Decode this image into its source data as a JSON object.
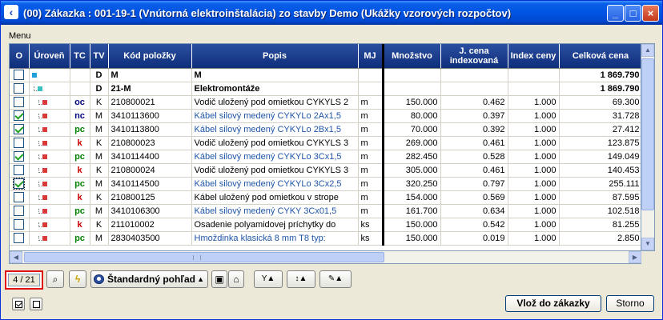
{
  "window": {
    "title": "(00)  Zákazka :  001-19-1 (Vnútorná elektroinštalácia) zo stavby Demo (Ukážky vzorových rozpočtov)",
    "min_glyph": "_",
    "max_glyph": "□",
    "close_glyph": "×"
  },
  "menu": {
    "label": "Menu"
  },
  "grid": {
    "columns": [
      "O",
      "Úroveň",
      "TC",
      "TV",
      "Kód položky",
      "Popis",
      "MJ",
      "Množstvo",
      "J. cena indexovaná",
      "Index ceny",
      "Celková cena"
    ],
    "rows": [
      {
        "checked": false,
        "level": "blue",
        "tc": "",
        "tc_color": "",
        "tv": "D",
        "code": "M",
        "desc": "M",
        "desc_color": "black",
        "mj": "",
        "qty": "",
        "price": "",
        "index": "",
        "total": "1 869.790",
        "bold": true
      },
      {
        "checked": false,
        "level": "teal",
        "tc": "",
        "tc_color": "",
        "tv": "D",
        "code": "21-M",
        "desc": "Elektromontáže",
        "desc_color": "black",
        "mj": "",
        "qty": "",
        "price": "",
        "index": "",
        "total": "1 869.790",
        "bold": true
      },
      {
        "checked": false,
        "level": "red",
        "tc": "oc",
        "tc_color": "navy",
        "tv": "K",
        "code": "210800021",
        "desc": "Vodič uložený pod omietkou CYKYLS 2",
        "desc_color": "black",
        "mj": "m",
        "qty": "150.000",
        "price": "0.462",
        "index": "1.000",
        "total": "69.300",
        "bold": false
      },
      {
        "checked": true,
        "level": "red",
        "tc": "nc",
        "tc_color": "navy",
        "tv": "M",
        "code": "3410113600",
        "desc": "Kábel silový medený CYKYLo 2Ax1,5",
        "desc_color": "blue",
        "mj": "m",
        "qty": "80.000",
        "price": "0.397",
        "index": "1.000",
        "total": "31.728",
        "bold": false
      },
      {
        "checked": true,
        "level": "red",
        "tc": "pc",
        "tc_color": "green",
        "tv": "M",
        "code": "3410113800",
        "desc": "Kábel silový medený CYKYLo 2Bx1,5",
        "desc_color": "blue",
        "mj": "m",
        "qty": "70.000",
        "price": "0.392",
        "index": "1.000",
        "total": "27.412",
        "bold": false
      },
      {
        "checked": false,
        "level": "red",
        "tc": "k",
        "tc_color": "red",
        "tv": "K",
        "code": "210800023",
        "desc": "Vodič uložený pod omietkou CYKYLS 3",
        "desc_color": "black",
        "mj": "m",
        "qty": "269.000",
        "price": "0.461",
        "index": "1.000",
        "total": "123.875",
        "bold": false
      },
      {
        "checked": true,
        "level": "red",
        "tc": "pc",
        "tc_color": "green",
        "tv": "M",
        "code": "3410114400",
        "desc": "Kábel silový medený CYKYLo 3Cx1,5",
        "desc_color": "blue",
        "mj": "m",
        "qty": "282.450",
        "price": "0.528",
        "index": "1.000",
        "total": "149.049",
        "bold": false
      },
      {
        "checked": false,
        "level": "red",
        "tc": "k",
        "tc_color": "red",
        "tv": "K",
        "code": "210800024",
        "desc": "Vodič uložený pod omietkou CYKYLS 3",
        "desc_color": "black",
        "mj": "m",
        "qty": "305.000",
        "price": "0.461",
        "index": "1.000",
        "total": "140.453",
        "bold": false
      },
      {
        "checked": true,
        "level": "red",
        "tc": "pc",
        "tc_color": "green",
        "tv": "M",
        "code": "3410114500",
        "desc": "Kábel silový medený CYKYLo 3Cx2,5",
        "desc_color": "blue",
        "mj": "m",
        "qty": "320.250",
        "price": "0.797",
        "index": "1.000",
        "total": "255.111",
        "bold": false,
        "focus": true
      },
      {
        "checked": false,
        "level": "red",
        "tc": "k",
        "tc_color": "red",
        "tv": "K",
        "code": "210800125",
        "desc": "Kábel uložený pod omietkou v strope",
        "desc_color": "black",
        "mj": "m",
        "qty": "154.000",
        "price": "0.569",
        "index": "1.000",
        "total": "87.595",
        "bold": false
      },
      {
        "checked": false,
        "level": "red",
        "tc": "pc",
        "tc_color": "green",
        "tv": "M",
        "code": "3410106300",
        "desc": "Kábel silový medený CYKY  3Cx01,5",
        "desc_color": "blue",
        "mj": "m",
        "qty": "161.700",
        "price": "0.634",
        "index": "1.000",
        "total": "102.518",
        "bold": false
      },
      {
        "checked": false,
        "level": "red",
        "tc": "k",
        "tc_color": "red",
        "tv": "K",
        "code": "211010002",
        "desc": "Osadenie polyamidovej príchytky do",
        "desc_color": "black",
        "mj": "ks",
        "qty": "150.000",
        "price": "0.542",
        "index": "1.000",
        "total": "81.255",
        "bold": false
      },
      {
        "checked": false,
        "level": "red",
        "tc": "pc",
        "tc_color": "green",
        "tv": "M",
        "code": "2830403500",
        "desc": "Hmoždinka klasická 8 mm T8  typ:",
        "desc_color": "blue",
        "mj": "ks",
        "qty": "150.000",
        "price": "0.019",
        "index": "1.000",
        "total": "2.850",
        "bold": false
      }
    ]
  },
  "toolbar": {
    "counter": "4 / 21",
    "binoculars_glyph": "⌕",
    "lightning_glyph": "ϟ",
    "view_label": "Štandardný pohľad",
    "combo_arrow": "▲",
    "save_glyph": "▣",
    "home_glyph": "⌂",
    "filter_glyph": "Y▲",
    "sort_glyph": "↕▲",
    "pen_glyph": "✎▲"
  },
  "buttons": {
    "insert": "Vlož do zákazky",
    "cancel": "Storno"
  }
}
